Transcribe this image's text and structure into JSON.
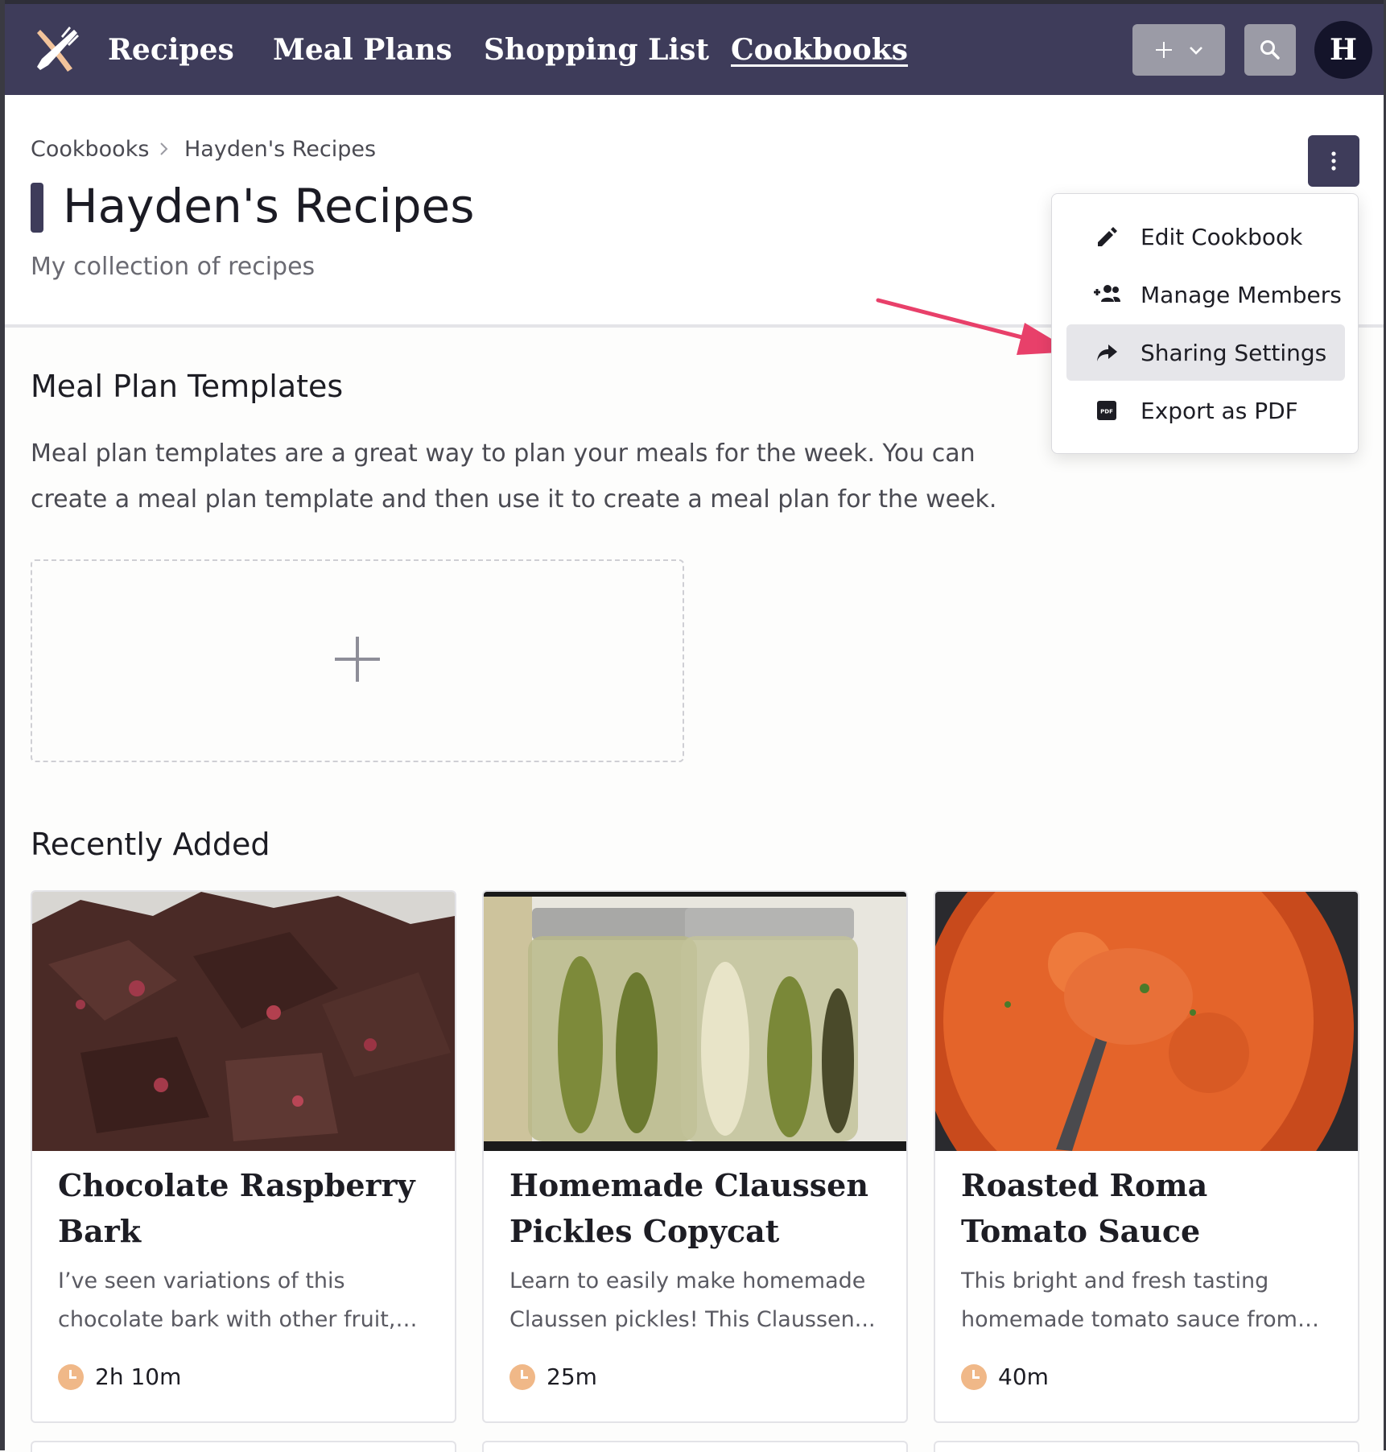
{
  "nav": {
    "logo_icon": "fork-knife-logo-icon",
    "links": [
      "Recipes",
      "Meal Plans",
      "Shopping List",
      "Cookbooks"
    ],
    "active": "Cookbooks",
    "avatar_initial": "H",
    "colors": {
      "bar": "#3e3c5a",
      "button": "#9b9ba6",
      "avatar": "#14142a"
    }
  },
  "breadcrumb": [
    "Cookbooks",
    "Hayden's Recipes"
  ],
  "page": {
    "title": "Hayden's Recipes",
    "subtitle": "My collection of recipes"
  },
  "menu": {
    "items": [
      {
        "label": "Edit Cookbook",
        "icon": "pencil-icon"
      },
      {
        "label": "Manage Members",
        "icon": "add-group-icon"
      },
      {
        "label": "Sharing Settings",
        "icon": "share-arrow-icon",
        "highlighted": true
      },
      {
        "label": "Export as PDF",
        "icon": "pdf-icon"
      }
    ],
    "annotation_arrow_color": "#e8406a"
  },
  "templates": {
    "title": "Meal Plan Templates",
    "description": "Meal plan templates are a great way to plan your meals for the week. You can create a meal plan template and then use it to create a meal plan for the week."
  },
  "recent": {
    "title": "Recently Added",
    "cards": [
      {
        "title": "Chocolate Raspberry Bark",
        "description": "I’ve seen variations of this chocolate bark with other fruit, but haven’t y...",
        "time": "2h 10m"
      },
      {
        "title": "Homemade Claussen Pickles Copycat",
        "description": "Learn to easily make homemade Claussen pickles! This Claussen...",
        "time": "25m"
      },
      {
        "title": "Roasted Roma Tomato Sauce",
        "description": "This bright and fresh tasting homemade tomato sauce from fres...",
        "time": "40m"
      }
    ]
  }
}
